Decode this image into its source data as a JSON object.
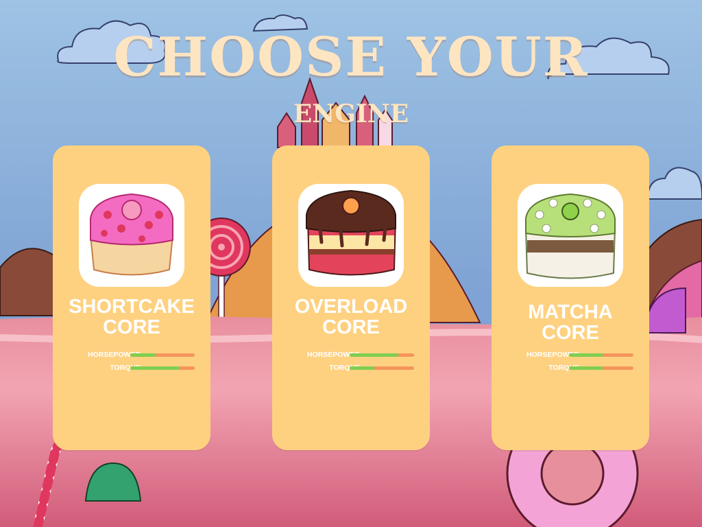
{
  "title": {
    "line1": "CHOOSE YOUR",
    "line2": "ENGINE"
  },
  "colors": {
    "sky": "#8fb4de",
    "card": "#fed181",
    "title": "#fde5c2",
    "bar_fill": "#7fcf4f",
    "bar_track": "#f4955c"
  },
  "engines": [
    {
      "line1": "SHORTCAKE",
      "line2": "CORE",
      "icon": "strawberry-shortcake-icon",
      "stats": [
        {
          "label": "HORSEPOWER",
          "value": 0.38
        },
        {
          "label": "TORQUE",
          "value": 0.75
        }
      ]
    },
    {
      "line1": "OVERLOAD",
      "line2": "CORE",
      "icon": "chocolate-layer-cake-icon",
      "stats": [
        {
          "label": "HORSEPOWER",
          "value": 0.75
        },
        {
          "label": "TORQUE",
          "value": 0.38
        }
      ]
    },
    {
      "line1": "MATCHA",
      "line2": "CORE",
      "icon": "matcha-cake-icon",
      "stats": [
        {
          "label": "HORSEPOWER",
          "value": 0.52
        },
        {
          "label": "TORQUE",
          "value": 0.52
        }
      ]
    }
  ]
}
